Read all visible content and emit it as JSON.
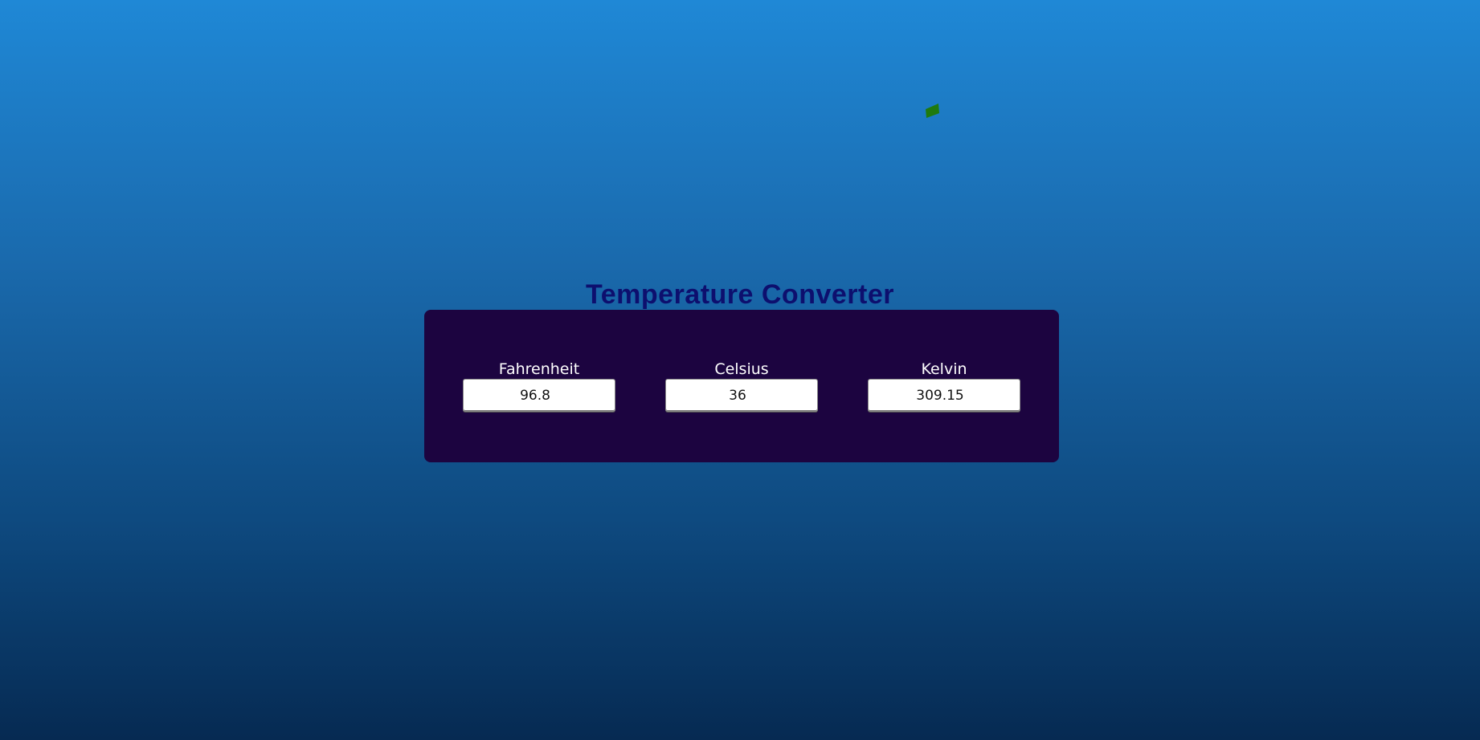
{
  "title": "Temperature Converter",
  "colors": {
    "title": "#0d0f6e",
    "panel": "#1c0440",
    "leaf": "#1f7a0e",
    "bg_top": "#1f88d6",
    "bg_bottom": "#062a52"
  },
  "decoration": {
    "icon": "green-leaf-icon"
  },
  "converter": {
    "fahrenheit": {
      "label": "Fahrenheit",
      "value": "96.8"
    },
    "celsius": {
      "label": "Celsius",
      "value": "36"
    },
    "kelvin": {
      "label": "Kelvin",
      "value": "309.15"
    }
  }
}
